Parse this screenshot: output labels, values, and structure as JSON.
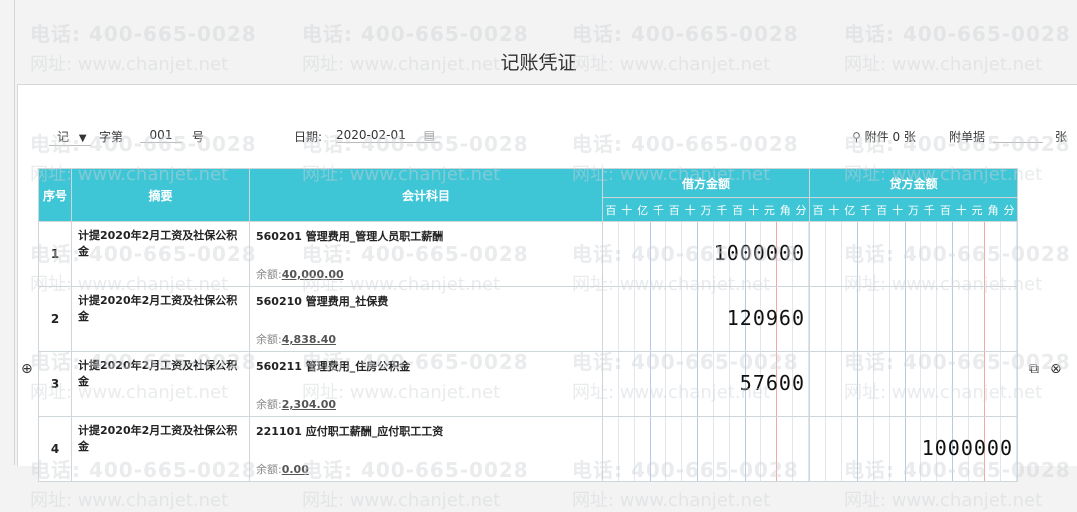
{
  "title": "记账凭证",
  "watermark": {
    "phone": "电话: 400-665-0028",
    "site": "网址: www.chanjet.net"
  },
  "header": {
    "voucher_type": "记",
    "zi_label": "字第",
    "number": "001",
    "hao_label": "号",
    "date_label": "日期:",
    "date_value": "2020-02-01",
    "attachment_label": "附件 0 张",
    "attach_doc_label": "附单据",
    "zhang_label": "张"
  },
  "columns": {
    "seq": "序号",
    "summary": "摘要",
    "account": "会计科目",
    "debit": "借方金额",
    "credit": "贷方金额",
    "digit_units": [
      "百",
      "十",
      "亿",
      "千",
      "百",
      "十",
      "万",
      "千",
      "百",
      "十",
      "元",
      "角",
      "分"
    ]
  },
  "balance_label": "余额:",
  "rows": [
    {
      "seq": "1",
      "summary": "计提2020年2月工资及社保公积金",
      "account": "560201 管理费用_管理人员职工薪酬",
      "balance": "40,000.00",
      "debit": "1000000",
      "credit": ""
    },
    {
      "seq": "2",
      "summary": "计提2020年2月工资及社保公积金",
      "account": "560210 管理费用_社保费",
      "balance": "4,838.40",
      "debit": "120960",
      "credit": ""
    },
    {
      "seq": "3",
      "summary": "计提2020年2月工资及社保公积金",
      "account": "560211 管理费用_住房公积金",
      "balance": "2,304.00",
      "debit": "57600",
      "credit": ""
    },
    {
      "seq": "4",
      "summary": "计提2020年2月工资及社保公积金",
      "account": "221101 应付职工薪酬_应付职工工资",
      "balance": "0.00",
      "debit": "",
      "credit": "1000000"
    }
  ]
}
